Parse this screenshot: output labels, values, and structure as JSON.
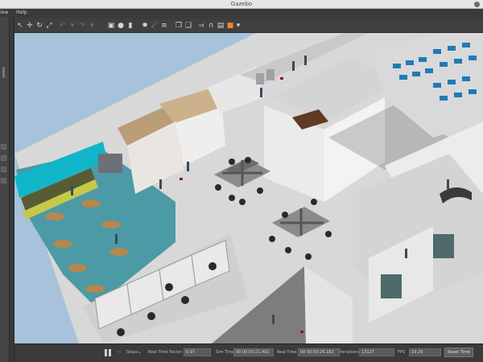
{
  "window": {
    "title": "Gazebo"
  },
  "menu": {
    "items": [
      "iew",
      "Help"
    ]
  },
  "toolbar": {
    "icons": [
      "select-arrow",
      "translate-cross",
      "rotate",
      "scale",
      "undo",
      "redo",
      "box",
      "sphere",
      "cylinder",
      "point-light",
      "spot-light",
      "directional-light",
      "copy",
      "paste",
      "align",
      "snap",
      "change-view",
      "screenshot"
    ]
  },
  "statusbar": {
    "steps_label": "Steps",
    "rtf_label": "Real Time Factor:",
    "rtf_value": "0.97",
    "sim_time_label": "Sim Time",
    "sim_time_value": "00 00:03:21.402",
    "real_time_label": "Real Time",
    "real_time_value": "00 00:03:26.182",
    "iterations_label": "Iterations",
    "iterations_value": "13127",
    "fps_label": "FPS",
    "fps_value": "19.29",
    "reset_time_label": "Reset Time"
  },
  "colors": {
    "sky": "#a9c4dc",
    "floor": "#dcdcdc",
    "cafeteria": "#4aa7b5",
    "wall": "#f0f0f0",
    "kitchen_wall": "#12b7c9",
    "wood": "#c4a17a"
  }
}
